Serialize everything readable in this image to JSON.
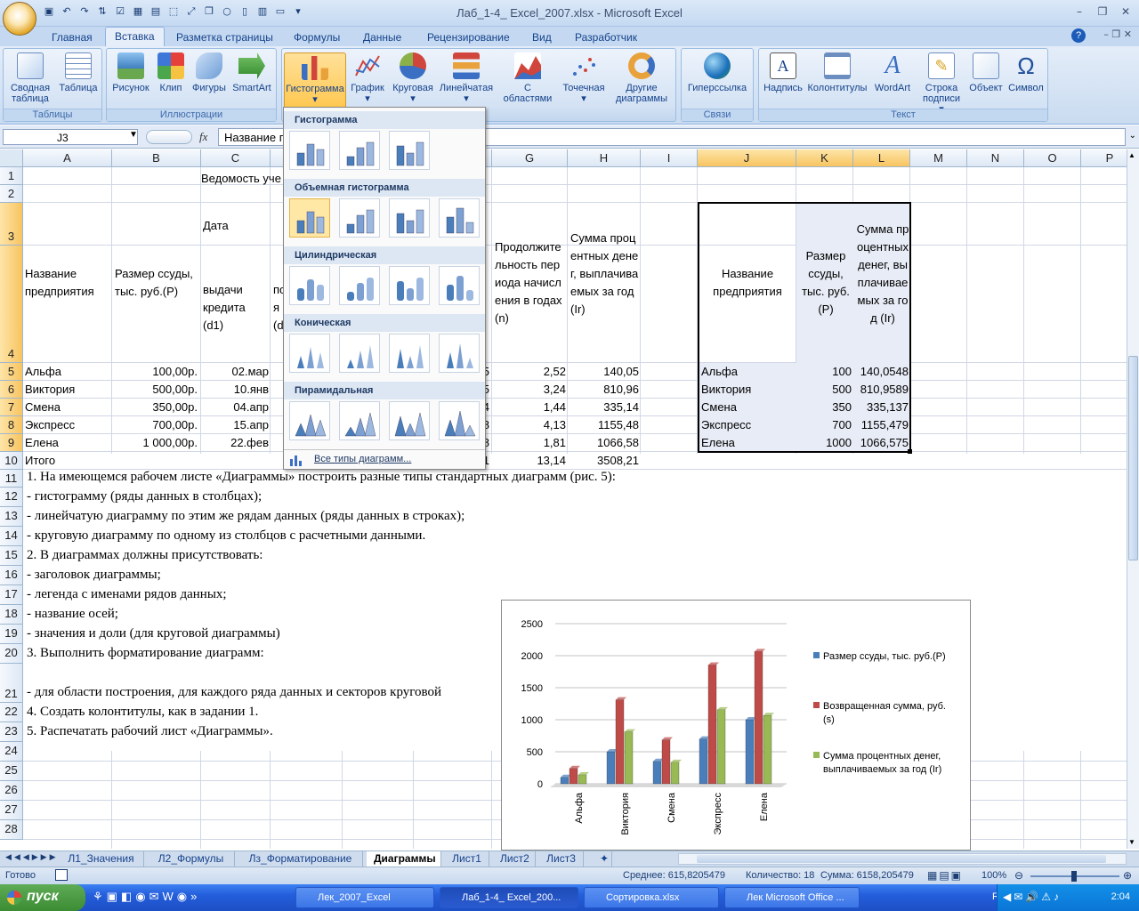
{
  "app": {
    "title": "Лаб_1-4_ Excel_2007.xlsx - Microsoft Excel"
  },
  "tabs": [
    "Главная",
    "Вставка",
    "Разметка страницы",
    "Формулы",
    "Данные",
    "Рецензирование",
    "Вид",
    "Разработчик"
  ],
  "ribbon": {
    "tables": {
      "label": "Таблицы",
      "pivot": "Сводная таблица",
      "table": "Таблица"
    },
    "illustrations": {
      "label": "Иллюстрации",
      "picture": "Рисунок",
      "clip": "Клип",
      "shapes": "Фигуры",
      "smartart": "SmartArt"
    },
    "charts": {
      "histogram": "Гистограмма",
      "graph": "График",
      "pie": "Круговая",
      "bar": "Линейчатая",
      "area": "С областями",
      "scatter": "Точечная",
      "other": "Другие диаграммы"
    },
    "links": {
      "label": "Связи",
      "hyperlink": "Гиперссылка"
    },
    "text": {
      "label": "Текст",
      "textbox": "Надпись",
      "headers": "Колонтитулы",
      "wordart": "WordArt",
      "signature": "Строка подписи",
      "object": "Объект",
      "symbol": "Символ"
    }
  },
  "formula": {
    "namebox": "J3",
    "fx": "fx",
    "content": "Название п"
  },
  "columns": [
    "A",
    "B",
    "C",
    "D",
    "E",
    "F",
    "G",
    "H",
    "I",
    "J",
    "K",
    "L",
    "M",
    "N",
    "O",
    "P"
  ],
  "rows": [
    "1",
    "2",
    "3",
    "4",
    "5",
    "6",
    "7",
    "8",
    "9",
    "10",
    "11",
    "12",
    "13",
    "14",
    "15",
    "16",
    "17",
    "18",
    "19",
    "20",
    "21",
    "22",
    "23",
    "24",
    "25",
    "26",
    "27",
    "28"
  ],
  "sheet": {
    "c1": "Ведомость уче",
    "a_head": "Название предприятия",
    "b_head": "Размер ссуды, тыс. руб.(P)",
    "c_date": "Дата",
    "c_head": "выдачи кредита (d1)",
    "d_head": "по я (d",
    "g_head": "Продолжительность периода начисления в годах (n)",
    "h_head": "Сумма процентных денег, выплачиваемых за год (Ir)",
    "j_head": "Название предприятия",
    "k_head": "Размер ссуды, тыс. руб.(P)",
    "l_head": "Сумма процентных денег, выплачиваемых за год (Ir)",
    "data": [
      {
        "a": "Альфа",
        "b": "100,00р.",
        "c": "02.мар",
        "f": "5",
        "g": "2,52",
        "h": "140,05",
        "j": "Альфа",
        "k": "100",
        "l": "140,0548"
      },
      {
        "a": "Виктория",
        "b": "500,00р.",
        "c": "10.янв",
        "f": "5",
        "g": "3,24",
        "h": "810,96",
        "j": "Виктория",
        "k": "500",
        "l": "810,9589"
      },
      {
        "a": "Смена",
        "b": "350,00р.",
        "c": "04.апр",
        "f": "4",
        "g": "1,44",
        "h": "335,14",
        "j": "Смена",
        "k": "350",
        "l": "335,137"
      },
      {
        "a": "Экспресс",
        "b": "700,00р.",
        "c": "15.апр",
        "f": "8",
        "g": "4,13",
        "h": "1155,48",
        "j": "Экспресс",
        "k": "700",
        "l": "1155,479"
      },
      {
        "a": "Елена",
        "b": "1 000,00р.",
        "c": "22.фев",
        "f": "8",
        "g": "1,81",
        "h": "1066,58",
        "j": "Елена",
        "k": "1000",
        "l": "1066,575"
      }
    ],
    "total": {
      "a": "Итого",
      "f": "1",
      "g": "13,14",
      "h": "3508,21"
    },
    "text_rows": [
      {
        "row": "11",
        "text": "1.     На имеющемся рабочем листе «Диаграммы» построить разные типы стандартных диаграмм (рис. 5):"
      },
      {
        "row": "12",
        "text": "-    гистограмму (ряды данных в столбцах);"
      },
      {
        "row": "13",
        "text": "-    линейчатую диаграмму по этим же рядам данных (ряды данных в строках);"
      },
      {
        "row": "14",
        "text": "-    круговую диаграмму по одному из столбцов с расчетными данными."
      },
      {
        "row": "15",
        "text": "2.     В диаграммах должны присутствовать:"
      },
      {
        "row": "16",
        "text": "-    заголовок диаграммы;"
      },
      {
        "row": "17",
        "text": "-    легенда с именами рядов данных;"
      },
      {
        "row": "18",
        "text": "-    название осей;"
      },
      {
        "row": "19",
        "text": "-    значения и доли (для круговой диаграммы)"
      },
      {
        "row": "20",
        "text": "3.     Выполнить форматирование диаграмм:"
      },
      {
        "row": "21",
        "text": "-    для области построения, для каждого ряда данных  и секторов круговой"
      },
      {
        "row": "22",
        "text": "4.     Создать колонтитулы, как в задании 1."
      },
      {
        "row": "23",
        "text": "5.     Распечатать рабочий лист «Диаграммы»."
      }
    ]
  },
  "chart_popup": {
    "sec1": "Гистограмма",
    "sec2": "Объемная гистограмма",
    "sec3": "Цилиндрическая",
    "sec4": "Коническая",
    "sec5": "Пирамидальная",
    "all": "Все типы диаграмм..."
  },
  "chart_data": {
    "type": "bar",
    "categories": [
      "Альфа",
      "Виктория",
      "Смена",
      "Экспресс",
      "Елена"
    ],
    "series": [
      {
        "name": "Размер ссуды, тыс. руб.(P)",
        "values": [
          100,
          500,
          350,
          700,
          1000
        ],
        "color": "#4a7ebb"
      },
      {
        "name": "Возвращенная сумма, руб. (s)",
        "values": [
          240,
          1310,
          685,
          1855,
          2065
        ],
        "color": "#be4b48"
      },
      {
        "name": "Сумма процентных денег, выплачиваемых за год (Ir)",
        "values": [
          140,
          811,
          335,
          1155,
          1067
        ],
        "color": "#98b954"
      }
    ],
    "ylim": [
      0,
      2500
    ],
    "yticks": [
      "0",
      "500",
      "1000",
      "1500",
      "2000",
      "2500"
    ],
    "legend": "right"
  },
  "sheet_tabs": [
    "Л1_Значения",
    "Л2_Формулы",
    "Лз_Форматирование",
    "Диаграммы",
    "Лист1",
    "Лист2",
    "Лист3"
  ],
  "status": {
    "ready": "Готово",
    "avg": "Среднее: 615,8205479",
    "count": "Количество: 18",
    "sum": "Сумма: 6158,205479",
    "zoom": "100%"
  },
  "taskbar": {
    "start": "пуск",
    "items": [
      "Лек_2007_Excel",
      "Лаб_1-4_ Excel_200...",
      "Сортировка.xlsx",
      "Лек Microsoft Office ..."
    ],
    "lang": "RU",
    "time": "2:04"
  }
}
